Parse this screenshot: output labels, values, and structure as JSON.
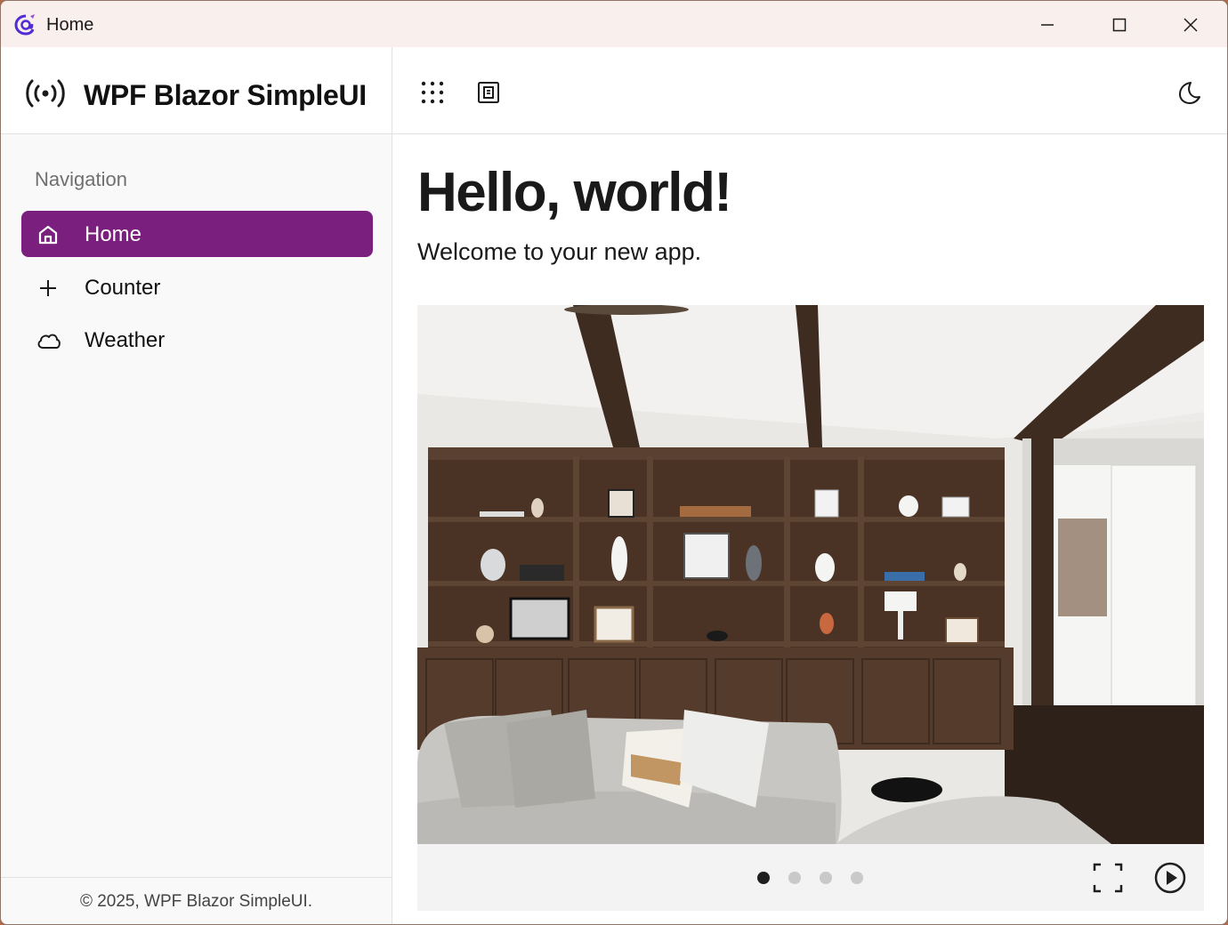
{
  "window": {
    "title": "Home"
  },
  "sidebar": {
    "brand": "WPF Blazor SimpleUI",
    "nav_heading": "Navigation",
    "items": [
      {
        "label": "Home",
        "icon": "home-icon",
        "active": true
      },
      {
        "label": "Counter",
        "icon": "plus-icon",
        "active": false
      },
      {
        "label": "Weather",
        "icon": "cloud-icon",
        "active": false
      }
    ],
    "footer": "© 2025, WPF Blazor SimpleUI."
  },
  "topbar": {
    "icons": [
      "apps-grid-icon",
      "panel-toggle-icon",
      "dark-mode-moon-icon"
    ]
  },
  "main": {
    "heading": "Hello, world!",
    "subheading": "Welcome to your new app."
  },
  "carousel": {
    "slide_count": 4,
    "active_index": 0,
    "image": "living-room-photo",
    "controls": [
      "fullscreen-icon",
      "play-icon"
    ]
  },
  "colors": {
    "accent": "#7a1f7d",
    "titlebar": "#f9efec",
    "sidebar_bg": "#f9f9f9"
  }
}
